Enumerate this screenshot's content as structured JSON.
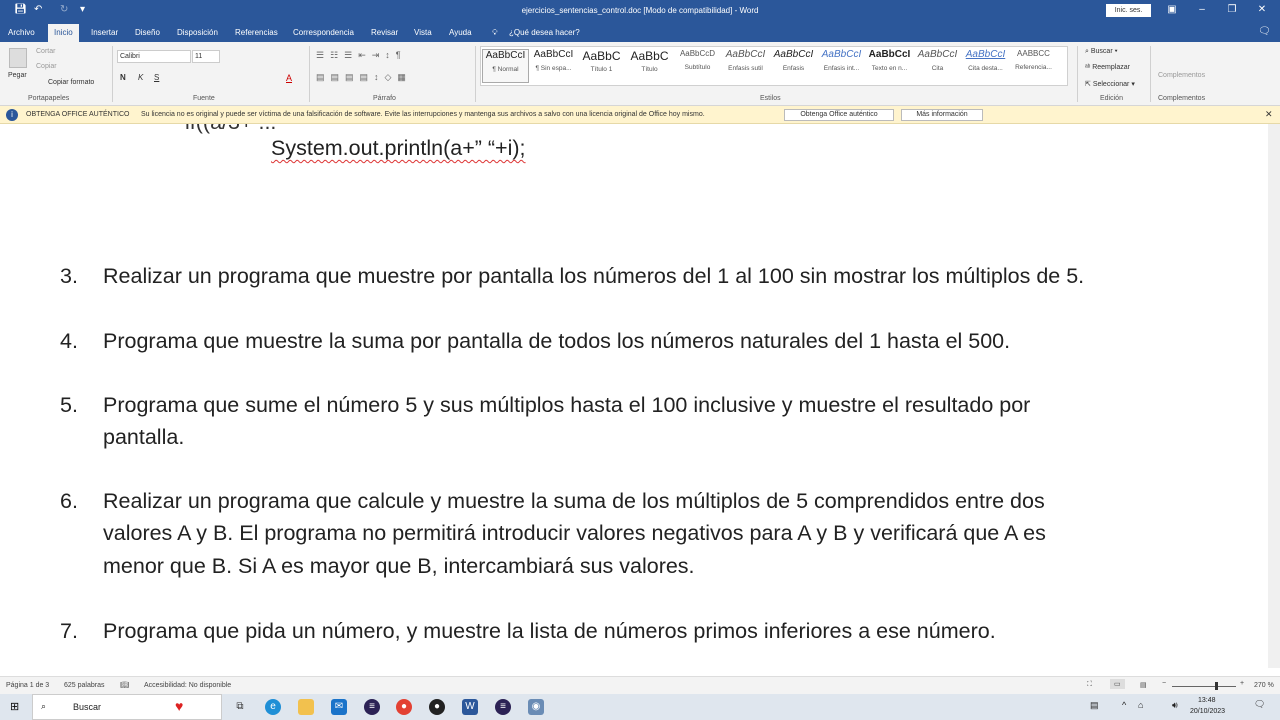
{
  "window": {
    "title": "ejercicios_sentencias_control.doc [Modo de compatibilidad]  -  Word",
    "signin": "Inic. ses."
  },
  "tabs": [
    "Archivo",
    "Inicio",
    "Insertar",
    "Diseño",
    "Disposición",
    "Referencias",
    "Correspondencia",
    "Revisar",
    "Vista",
    "Ayuda"
  ],
  "tell_me": "¿Qué desea hacer?",
  "clipboard": {
    "paste": "Pegar",
    "cut": "Cortar",
    "copy": "Copiar",
    "format_painter": "Copiar formato",
    "label": "Portapapeles"
  },
  "font": {
    "name": "Calibri",
    "size": "11",
    "label": "Fuente"
  },
  "paragraph": {
    "label": "Párrafo"
  },
  "styles": {
    "label": "Estilos",
    "items": [
      {
        "sample": "AaBbCcI",
        "name": "¶ Normal"
      },
      {
        "sample": "AaBbCcI",
        "name": "¶ Sin espa..."
      },
      {
        "sample": "AaBbC",
        "name": "Título 1"
      },
      {
        "sample": "AaBbC",
        "name": "Título"
      },
      {
        "sample": "AaBbCcD",
        "name": "Subtítulo"
      },
      {
        "sample": "AaBbCcI",
        "name": "Énfasis sutil"
      },
      {
        "sample": "AaBbCcI",
        "name": "Énfasis"
      },
      {
        "sample": "AaBbCcI",
        "name": "Énfasis int..."
      },
      {
        "sample": "AaBbCcI",
        "name": "Texto en n..."
      },
      {
        "sample": "AaBbCcI",
        "name": "Cita"
      },
      {
        "sample": "AaBbCcI",
        "name": "Cita desta..."
      },
      {
        "sample": "AABBCC",
        "name": "Referencia..."
      }
    ]
  },
  "editing": {
    "find": "Buscar",
    "replace": "Reemplazar",
    "select": "Seleccionar",
    "label": "Edición"
  },
  "addins": {
    "button": "Complementos",
    "label": "Complementos"
  },
  "notice": {
    "title": "OBTENGA OFFICE AUTÉNTICO",
    "message": "Su licencia no es original y puede ser víctima de una falsificación de software. Evite las interrupciones y mantenga sus archivos a salvo con una licencia original de Office hoy mismo.",
    "btn1": "Obtenga Office auténtico",
    "btn2": "Más información"
  },
  "document": {
    "code_line": "System.out.println(a+” “+i);",
    "items": [
      {
        "num": "3.",
        "lines": [
          "Realizar un programa que muestre por pantalla los números del 1 al 100 sin mostrar los múltiplos de 5."
        ]
      },
      {
        "num": "4.",
        "lines": [
          "Programa que muestre la suma por pantalla de todos los números naturales del 1 hasta el 500."
        ]
      },
      {
        "num": "5.",
        "lines": [
          "Programa que sume el número 5 y sus múltiplos hasta el 100 inclusive y muestre el resultado por",
          "pantalla."
        ]
      },
      {
        "num": "6.",
        "lines": [
          "Realizar un programa que calcule y muestre la suma de los múltiplos de 5 comprendidos entre dos",
          "valores A y B. El programa no permitirá introducir valores negativos para A y B y verificará que A es",
          "menor que B. Si A es mayor que B, intercambiará sus valores."
        ]
      },
      {
        "num": "7.",
        "lines": [
          "Programa que pida un número, y muestre la lista de números primos inferiores a ese número."
        ]
      }
    ]
  },
  "status": {
    "page": "Página 1 de 3",
    "words": "625 palabras",
    "accessibility": "Accesibilidad: No disponible",
    "zoom": "270 %"
  },
  "taskbar": {
    "search": "Buscar",
    "time": "13:48",
    "date": "20/10/2023"
  }
}
